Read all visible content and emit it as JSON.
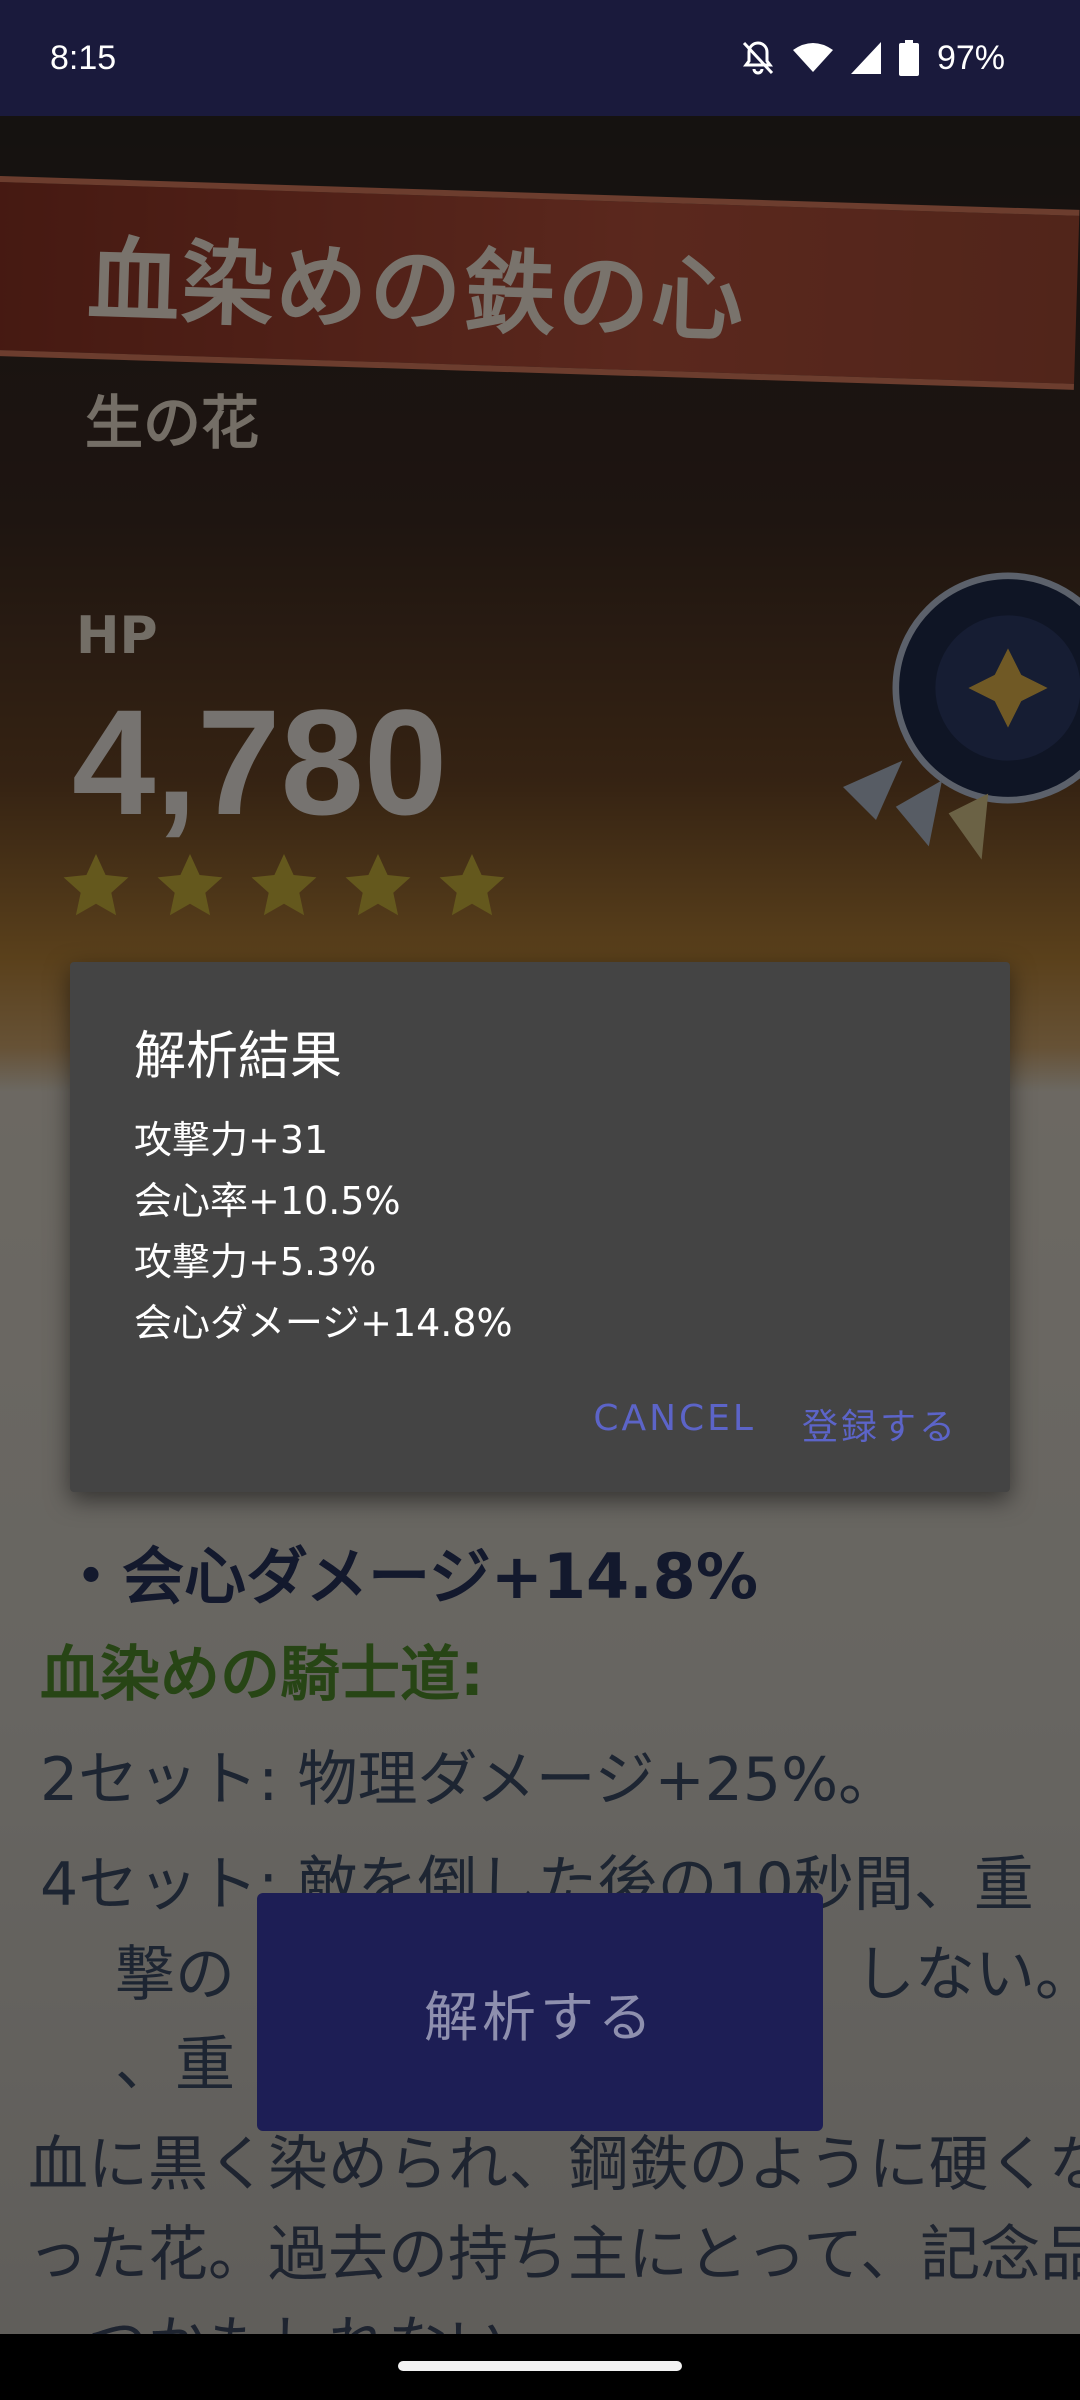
{
  "status_bar": {
    "time": "8:15",
    "battery": "97%",
    "icons": [
      "bell-off-icon",
      "wifi-icon",
      "signal-icon",
      "battery-icon"
    ]
  },
  "photo": {
    "artifact_name": "血染めの鉄の心",
    "slot": "生の花",
    "main_stat_label": "HP",
    "main_stat_value": "4,780",
    "stars": 5,
    "substat_visible": "・会心ダメージ+14.8%",
    "set_name": "血染めの騎士道:",
    "set_2": "2セット: 物理ダメージ+25%。",
    "set_4_a": "4セット: 敵を倒した後の10秒間、重",
    "set_4_b": "撃の",
    "set_4_b_end": "しない。ま",
    "set_4_c": "、重",
    "description_1": "血に黒く染められ、鋼鉄のように硬くな",
    "description_2": "った花。過去の持ち主にとって、記念品",
    "description_3": "一つかもしれない。"
  },
  "analyze_button": {
    "label": "解析する"
  },
  "dialog": {
    "title": "解析結果",
    "lines": [
      "攻撃力+31",
      "会心率+10.5%",
      "攻撃力+5.3%",
      "会心ダメージ+14.8%"
    ],
    "cancel_label": "CANCEL",
    "confirm_label": "登録する"
  },
  "colors": {
    "status_bar_bg": "#1a1a3c",
    "dialog_bg": "#444444",
    "dialog_action": "#5c64c8",
    "button_bg": "#1d1e55"
  }
}
